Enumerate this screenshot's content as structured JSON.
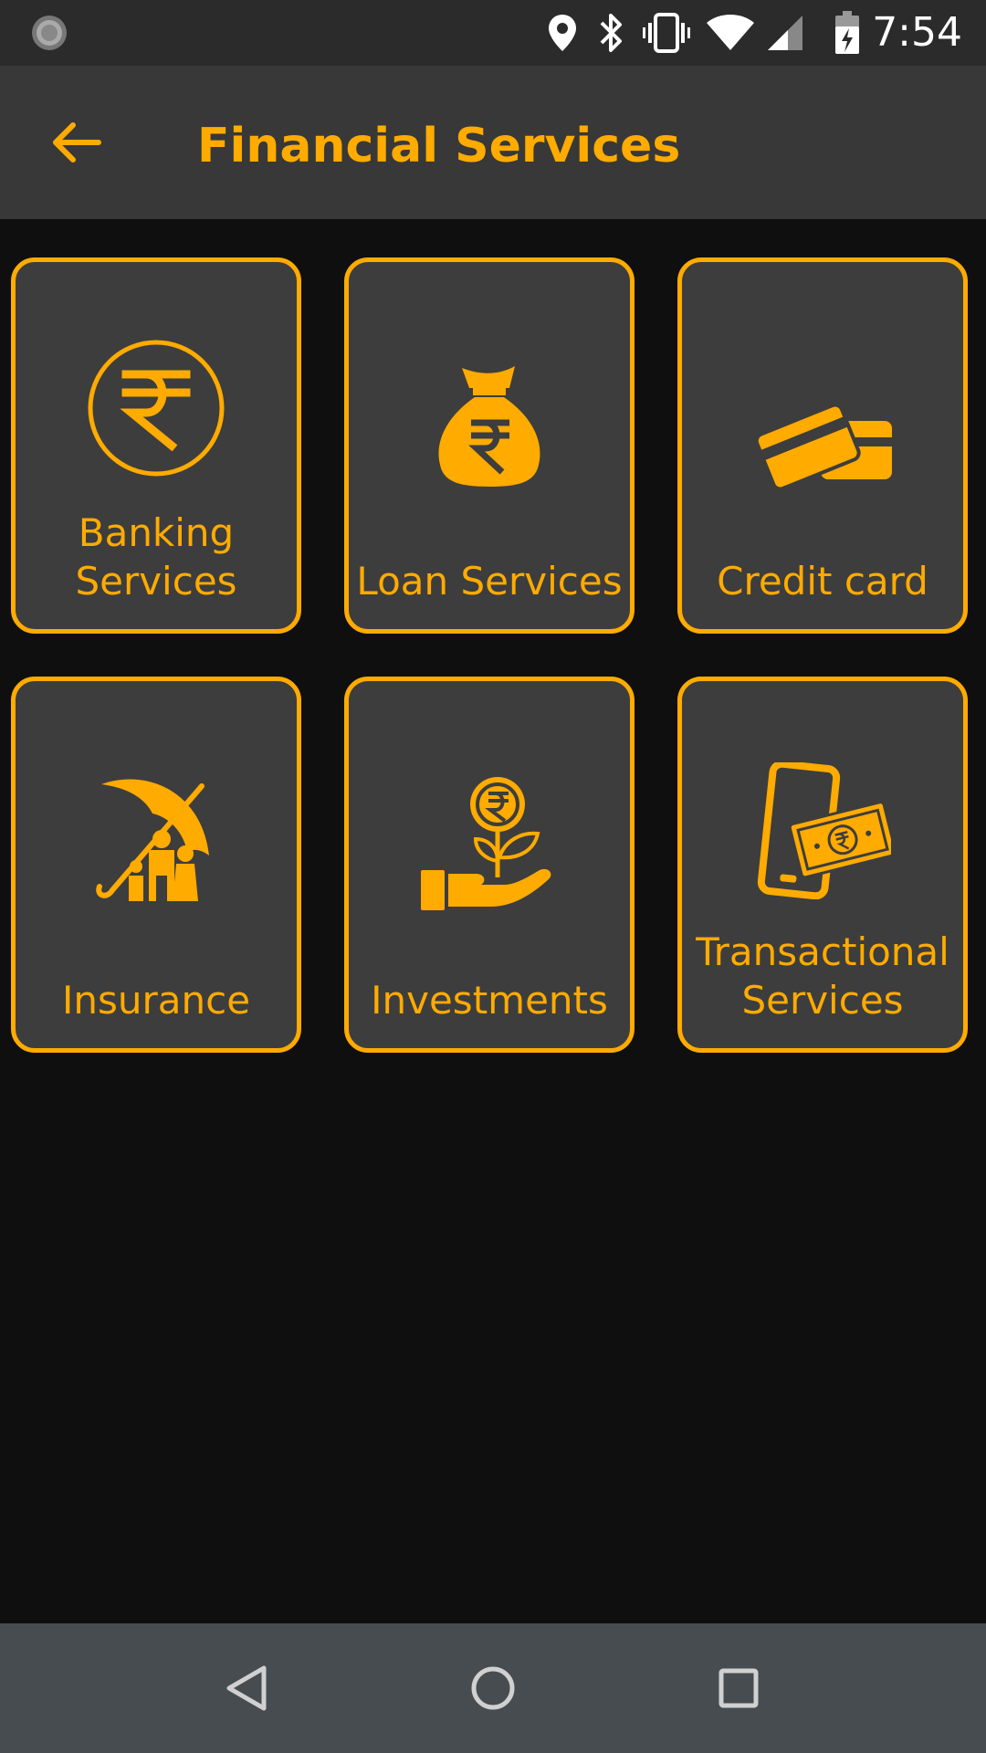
{
  "status_bar": {
    "time": "7:54",
    "icons": [
      "sync-icon",
      "location-icon",
      "bluetooth-icon",
      "vibrate-icon",
      "wifi-icon",
      "cell-signal-icon",
      "battery-charging-icon"
    ]
  },
  "app_bar": {
    "title": "Financial Services",
    "back_icon": "arrow-back-icon"
  },
  "tiles": [
    {
      "label": "Banking Services",
      "icon": "rupee-circle-icon"
    },
    {
      "label": "Loan Services",
      "icon": "money-bag-icon"
    },
    {
      "label": "Credit card",
      "icon": "credit-cards-icon"
    },
    {
      "label": "Insurance",
      "icon": "umbrella-family-icon"
    },
    {
      "label": "Investments",
      "icon": "hand-plant-coin-icon"
    },
    {
      "label": "Transactional Services",
      "icon": "phone-cash-icon"
    }
  ],
  "nav_bar": {
    "icons": [
      "nav-back-icon",
      "nav-home-icon",
      "nav-recents-icon"
    ]
  },
  "colors": {
    "accent": "#ffab00",
    "app_bar": "#383838",
    "tile_bg": "#3d3d3d",
    "background": "#0f0f0f",
    "nav_bar": "#474c50"
  }
}
